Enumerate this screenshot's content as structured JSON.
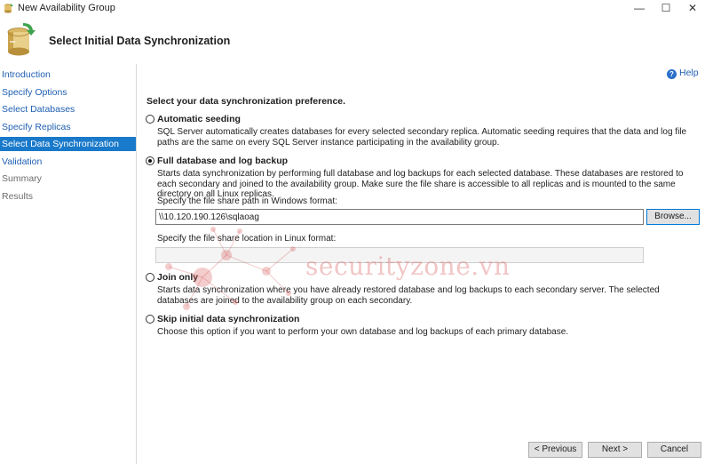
{
  "window": {
    "title": "New Availability Group",
    "minimize": "—",
    "maximize": "☐",
    "close": "✕"
  },
  "header": {
    "page_title": "Select Initial Data Synchronization",
    "icon": "database-sync-icon"
  },
  "sidebar": {
    "items": [
      {
        "label": "Introduction",
        "state": "link"
      },
      {
        "label": "Specify Options",
        "state": "link"
      },
      {
        "label": "Select Databases",
        "state": "link"
      },
      {
        "label": "Specify Replicas",
        "state": "link"
      },
      {
        "label": "Select Data Synchronization",
        "state": "selected"
      },
      {
        "label": "Validation",
        "state": "link"
      },
      {
        "label": "Summary",
        "state": "disabled"
      },
      {
        "label": "Results",
        "state": "disabled"
      }
    ]
  },
  "help": {
    "label": "Help",
    "icon": "help-icon"
  },
  "main": {
    "prompt": "Select your data synchronization preference.",
    "options": [
      {
        "label": "Automatic seeding",
        "selected": false,
        "description": "SQL Server automatically creates databases for every selected secondary replica. Automatic seeding requires that the data and log file paths are the same on every SQL Server instance participating in the availability group."
      },
      {
        "label": "Full database and log backup",
        "selected": true,
        "description": "Starts data synchronization by performing full database and log backups for each selected database. These databases are restored to each secondary and joined to the availability group. Make sure the file share is accessible to all replicas and is mounted to the same directory on all Linux replicas."
      },
      {
        "label": "Join only",
        "selected": false,
        "description": "Starts data synchronization where you have already restored database and log backups to each secondary server. The selected databases are joined to the availability group on each secondary."
      },
      {
        "label": "Skip initial data synchronization",
        "selected": false,
        "description": "Choose this option if you want to perform your own database and log backups of each primary database."
      }
    ],
    "windows_path": {
      "label": "Specify the file share path in Windows format:",
      "value": "\\\\10.120.190.126\\sqlaoag",
      "browse_label": "Browse..."
    },
    "linux_path": {
      "label": "Specify the file share location in Linux format:",
      "value": ""
    }
  },
  "footer": {
    "previous_label": "< Previous",
    "next_label": "Next >",
    "cancel_label": "Cancel"
  },
  "watermark": {
    "text": "securityzone.vn",
    "color": "#d65a5a"
  }
}
